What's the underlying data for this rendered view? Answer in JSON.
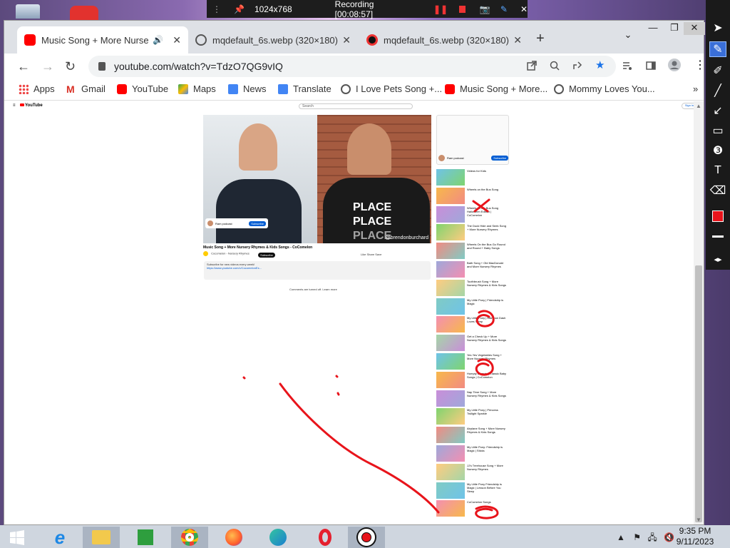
{
  "recorder": {
    "resolution": "1024x768",
    "status": "Recording [00:08:57]"
  },
  "browser": {
    "tabs": [
      {
        "title": "Music Song + More Nursery",
        "active": true
      },
      {
        "title": "mqdefault_6s.webp (320×180)",
        "active": false
      },
      {
        "title": "mqdefault_6s.webp (320×180)",
        "active": false
      }
    ],
    "url": "youtube.com/watch?v=TdzO7QG9vIQ",
    "bookmarks": [
      {
        "label": "Apps",
        "icon": "apps-grid-icon"
      },
      {
        "label": "Gmail",
        "icon": "gmail-icon"
      },
      {
        "label": "YouTube",
        "icon": "youtube-icon"
      },
      {
        "label": "Maps",
        "icon": "maps-icon"
      },
      {
        "label": "News",
        "icon": "news-icon"
      },
      {
        "label": "Translate",
        "icon": "translate-icon"
      },
      {
        "label": "I Love Pets Song +...",
        "icon": "globe-icon"
      },
      {
        "label": "Music Song + More...",
        "icon": "youtube-icon"
      },
      {
        "label": "Mommy Loves You...",
        "icon": "globe-icon"
      }
    ]
  },
  "youtube": {
    "logo": "YouTube",
    "search_placeholder": "Search",
    "signin": "Sign in",
    "video_handle": "@brendonburchard",
    "overlay_channel": "Ram podcast",
    "overlay_subscribe": "Subscribe",
    "shirt_text": [
      "PLACE",
      "PLACE",
      "PLACE"
    ],
    "title": "Music Song + More Nursery Rhymes & Kids Songs - CoComelon",
    "channel": "Cocomelon - Nursery Rhymes",
    "subscribe": "Subscribe",
    "actions": "Like  Share  Save",
    "desc_lines": [
      "Subscribe for new videos every week!",
      "https://www.youtube.com/c/CocomelonEs..."
    ],
    "comments_off": "Comments are turned off. Learn more",
    "ad_channel": "Ram podcast",
    "ad_subscribe": "Subscribe",
    "sidebar": [
      "Videos for Kids",
      "Wheels on the Bus Song",
      "Wheels on the Bus Song Halloween Edition | CoComelon",
      "The Duck Hide and Seek Song + More Nursery Rhymes",
      "Wheels On the Bus Go Round and Round + Baby Songs",
      "Bath Song + Old MacDonald and More Nursery Rhymes",
      "Toothbrush Song + More Nursery Rhymes & Kids Songs",
      "My Little Pony | Friendship is Magic",
      "My Little Pony | Rainbow Dash Loves Sleep",
      "Get a Check Up + More Nursery Rhymes & Kids Songs",
      "Yes Yes Vegetables Song + More Nursery Rhymes",
      "Humpty Dumpty | Classic Baby Songs | CoComelon",
      "Nap Time Song + More Nursery Rhymes & Kids Songs",
      "My Little Pony | Princess Twilight Sparkle",
      "Airplane Song + More Nursery Rhymes & Kids Songs",
      "My Little Pony: Friendship is Magic | Sticks",
      "JJ's Treehouse Song + More Nursery Rhymes",
      "My Little Pony Friendship is Magic | Lesson Before You Sleep",
      "CoComelon Songs"
    ]
  },
  "taskbar": {
    "time": "9:35 PM",
    "date": "9/11/2023"
  },
  "colors": {
    "youtube_red": "#ff0000",
    "annotation_red": "#e8141b",
    "chrome_tabstrip": "#dee1e6",
    "toolbox_active": "#3a6fd8"
  }
}
